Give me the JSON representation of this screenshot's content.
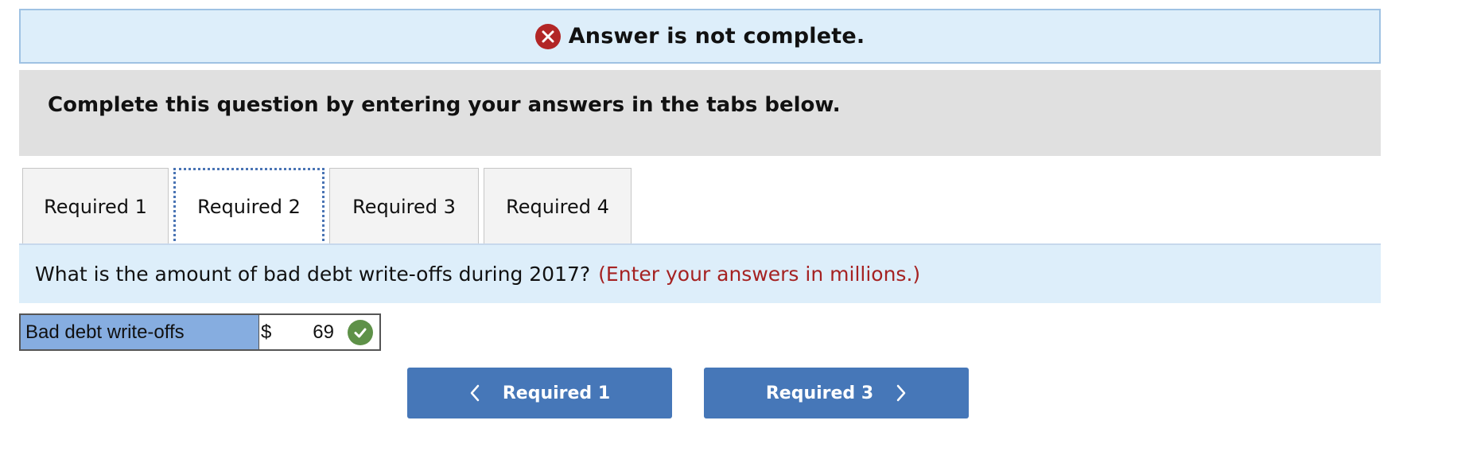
{
  "banner": {
    "text": "Answer is not complete."
  },
  "instructions": {
    "text": "Complete this question by entering your answers in the tabs below."
  },
  "tabs": [
    {
      "label": "Required 1",
      "active": false
    },
    {
      "label": "Required 2",
      "active": true
    },
    {
      "label": "Required 3",
      "active": false
    },
    {
      "label": "Required 4",
      "active": false
    }
  ],
  "question": {
    "text": "What is the amount of bad debt write-offs during 2017?",
    "hint": "(Enter your answers in millions.)"
  },
  "answer": {
    "label": "Bad debt write-offs",
    "currency": "$",
    "value": "69",
    "status": "correct"
  },
  "navigation": {
    "prev_label": "Required 1",
    "next_label": "Required 3"
  },
  "colors": {
    "banner_bg": "#ddeefa",
    "error_icon": "#b22626",
    "hint_text": "#a52222",
    "label_bg": "#86ade0",
    "check_icon": "#5e9148",
    "button_bg": "#4677b8"
  }
}
